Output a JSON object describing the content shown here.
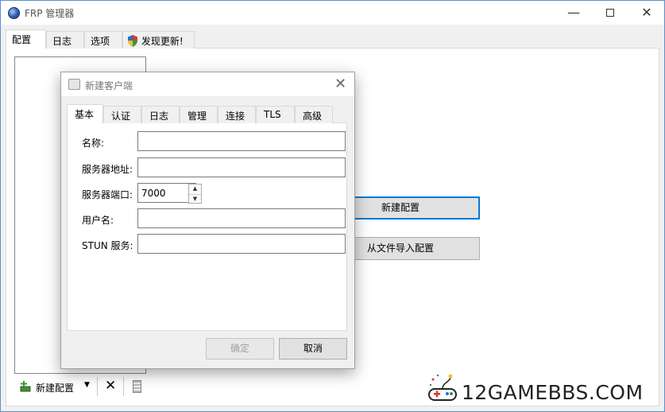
{
  "app": {
    "title": "FRP 管理器",
    "window_controls": {
      "minimize": "—",
      "close": "✕"
    }
  },
  "main_tabs": [
    {
      "label": "配置",
      "active": true
    },
    {
      "label": "日志",
      "active": false
    },
    {
      "label": "选项",
      "active": false
    },
    {
      "label": "发现更新!",
      "active": false,
      "icon": "shield-icon"
    }
  ],
  "main": {
    "new_config_button": "新建配置",
    "import_config_button": "从文件导入配置"
  },
  "toolbar": {
    "new_config_label": "新建配置",
    "dropdown": "▼",
    "delete": "✕"
  },
  "dialog": {
    "title": "新建客户端",
    "close": "✕",
    "tabs": [
      {
        "label": "基本",
        "active": true
      },
      {
        "label": "认证"
      },
      {
        "label": "日志"
      },
      {
        "label": "管理"
      },
      {
        "label": "连接"
      },
      {
        "label": "TLS"
      },
      {
        "label": "高级"
      }
    ],
    "fields": {
      "name_label": "名称:",
      "name_value": "",
      "server_addr_label": "服务器地址:",
      "server_addr_value": "",
      "server_port_label": "服务器端口:",
      "server_port_value": "7000",
      "username_label": "用户名:",
      "username_value": "",
      "stun_label": "STUN 服务:",
      "stun_value": ""
    },
    "spin_up": "▲",
    "spin_down": "▼",
    "ok_button": "确定",
    "cancel_button": "取消"
  },
  "watermark": {
    "text": "12GAMEBBS.COM"
  },
  "colors": {
    "accent": "#0078d7",
    "window_border": "#5a8fd0",
    "shield_red": "#d83b2b",
    "shield_green": "#2c9b3f",
    "shield_yellow": "#f2c12e"
  }
}
